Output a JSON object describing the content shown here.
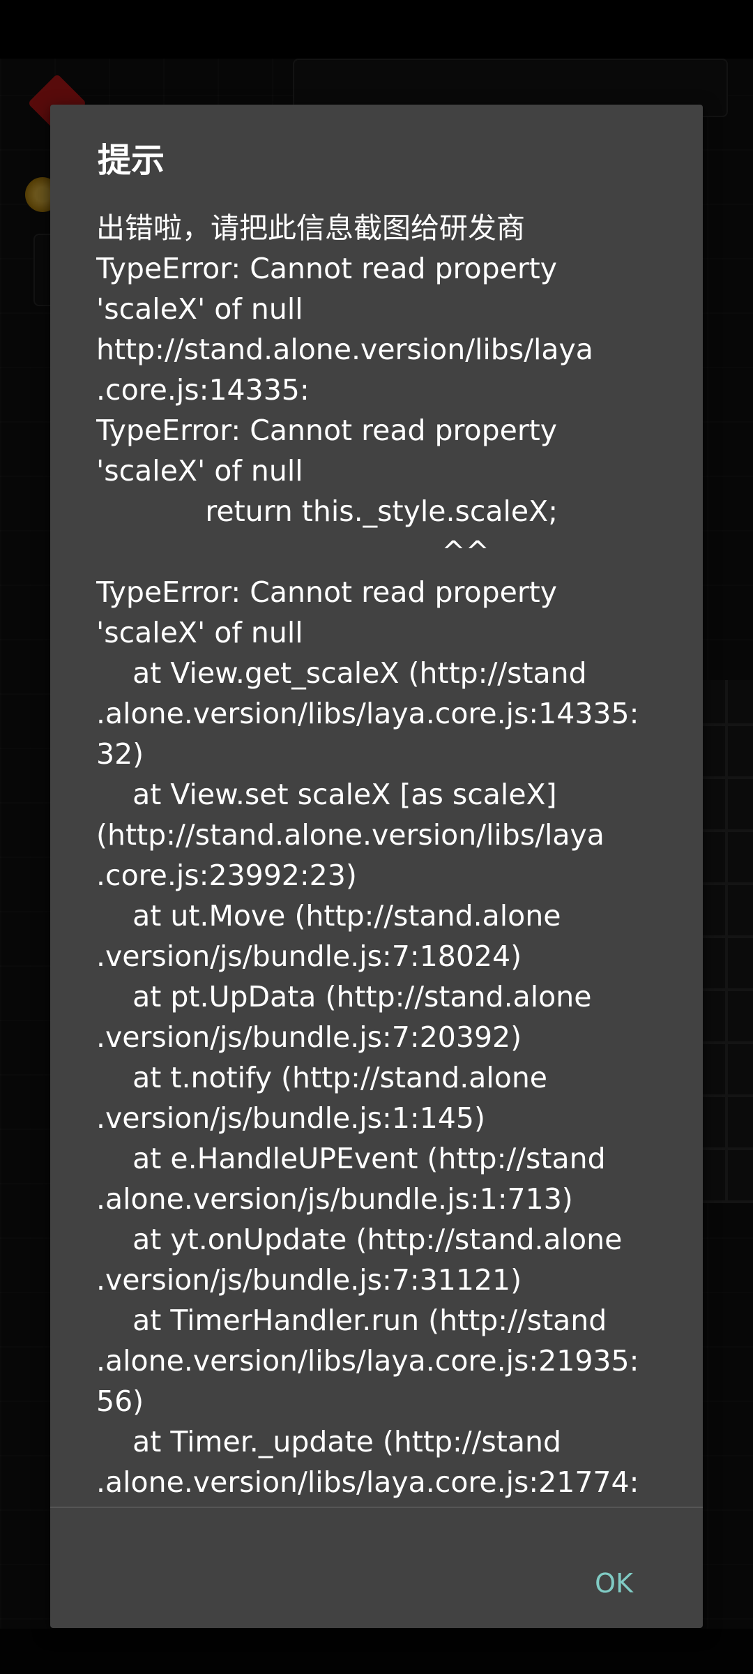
{
  "dialog": {
    "title": "提示",
    "message_lines": [
      "出错啦，请把此信息截图给研发商",
      "TypeError: Cannot read property",
      "'scaleX' of null",
      "http://stand.alone.version/libs/laya",
      ".core.js:14335:",
      "TypeError: Cannot read property",
      "'scaleX' of null",
      "            return this._style.scaleX;",
      "                                      ^^",
      "TypeError: Cannot read property",
      "'scaleX' of null",
      "    at View.get_scaleX (http://stand",
      ".alone.version/libs/laya.core.js:14335:",
      "32)",
      "    at View.set scaleX [as scaleX]",
      "(http://stand.alone.version/libs/laya",
      ".core.js:23992:23)",
      "    at ut.Move (http://stand.alone",
      ".version/js/bundle.js:7:18024)",
      "    at pt.UpData (http://stand.alone",
      ".version/js/bundle.js:7:20392)",
      "    at t.notify (http://stand.alone",
      ".version/js/bundle.js:1:145)",
      "    at e.HandleUPEvent (http://stand",
      ".alone.version/js/bundle.js:1:713)",
      "    at yt.onUpdate (http://stand.alone",
      ".version/js/bundle.js:7:31121)",
      "    at TimerHandler.run (http://stand",
      ".alone.version/libs/laya.core.js:21935:",
      "56)",
      "    at Timer._update (http://stand",
      ".alone.version/libs/laya.core.js:21774:"
    ],
    "ok_label": "OK"
  },
  "colors": {
    "dialog_bg": "#424242",
    "accent": "#80cbc4",
    "text": "#ffffff"
  }
}
